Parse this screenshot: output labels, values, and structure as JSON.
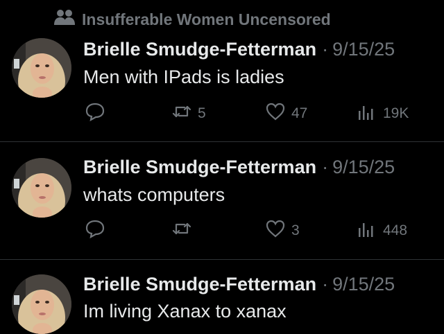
{
  "community": {
    "name": "Insufferable Women Uncensored",
    "icon": "people-icon"
  },
  "tweets": [
    {
      "author": "Brielle Smudge-Fetterman",
      "date": "9/15/25",
      "text": "Men with IPads is ladies",
      "reply_count": "",
      "retweet_count": "5",
      "like_count": "47",
      "view_count": "19K"
    },
    {
      "author": "Brielle Smudge-Fetterman",
      "date": "9/15/25",
      "text": "whats computers",
      "reply_count": "",
      "retweet_count": "",
      "like_count": "3",
      "view_count": "448"
    },
    {
      "author": "Brielle Smudge-Fetterman",
      "date": "9/15/25",
      "text": "Im living Xanax to xanax"
    }
  ],
  "colors": {
    "background": "#000000",
    "text": "#e7e9ea",
    "muted": "#71767b",
    "divider": "#2f3336"
  }
}
